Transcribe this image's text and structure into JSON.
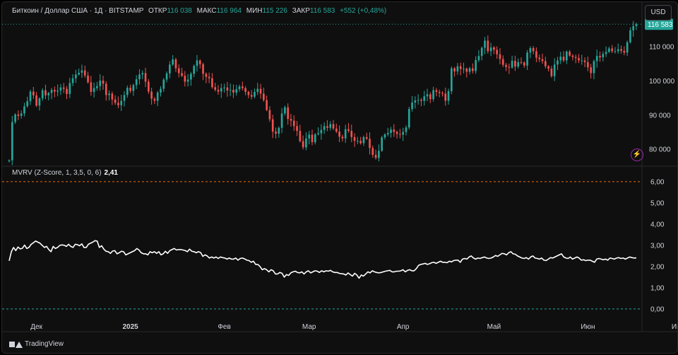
{
  "header": {
    "symbol": "Биткоин / Доллар США · 1Д · BITSTAMP",
    "open_label": "ОТКР",
    "open_value": "116 038",
    "high_label": "МАКС",
    "high_value": "116 964",
    "low_label": "МИН",
    "low_value": "115 226",
    "close_label": "ЗАКР",
    "close_value": "116 583",
    "change": "+552 (+0,48%)"
  },
  "currency_button": "USD",
  "indicator": {
    "name": "MVRV (Z-Score, 1, 3,5, 0, 6)",
    "value": "2,41"
  },
  "footer": {
    "brand": "TradingView"
  },
  "colors": {
    "up": "#26a69a",
    "down": "#ef5350",
    "line": "#ffffff",
    "price_tag": "#26a69a",
    "upper_band": "#ef6c00",
    "lower_band": "#26a69a"
  },
  "chart_data": [
    {
      "type": "candlestick",
      "title": "Биткоин / Доллар США · 1Д · BITSTAMP",
      "price_axis_ticks": [
        "80 000",
        "90 000",
        "100 000",
        "110 000"
      ],
      "price_tick_values": [
        80000,
        90000,
        100000,
        110000
      ],
      "ylim": [
        75500,
        118500
      ],
      "last_price_label": "116 583",
      "last_price": 116583,
      "time_axis_labels": [
        "Дек",
        "2025",
        "Фев",
        "Мар",
        "Апр",
        "Май",
        "Июн",
        "Июл"
      ],
      "time_axis_label_index": [
        9,
        40,
        71,
        99,
        130,
        160,
        191,
        221
      ],
      "series": [
        {
          "name": "Close",
          "start_open": 76500,
          "close": [
            76800,
            88000,
            90200,
            89800,
            90500,
            92600,
            94100,
            96900,
            95800,
            92800,
            94900,
            97300,
            95800,
            96500,
            97400,
            96900,
            97200,
            98100,
            97700,
            96200,
            99400,
            100800,
            101900,
            102400,
            103100,
            101600,
            99600,
            96800,
            97900,
            98500,
            100100,
            99200,
            95900,
            96300,
            94600,
            93600,
            92900,
            94200,
            95900,
            98000,
            97100,
            98800,
            100500,
            101900,
            102300,
            99800,
            96900,
            94800,
            94200,
            96600,
            97700,
            100400,
            102200,
            104800,
            106300,
            103700,
            102300,
            101500,
            99800,
            100400,
            102100,
            104400,
            106000,
            104900,
            102100,
            101200,
            100800,
            98200,
            97400,
            96900,
            97900,
            98100,
            97200,
            97400,
            96600,
            97600,
            98400,
            97900,
            96800,
            95900,
            95400,
            96800,
            97700,
            96300,
            94400,
            91500,
            88800,
            85200,
            84600,
            86300,
            90500,
            92300,
            88900,
            88400,
            86800,
            85400,
            82400,
            80600,
            83200,
            84300,
            82100,
            84400,
            84700,
            85700,
            86800,
            86300,
            87400,
            86100,
            85200,
            83700,
            83200,
            85900,
            85400,
            83600,
            82500,
            82500,
            81800,
            83600,
            83100,
            80400,
            78400,
            77500,
            79600,
            83500,
            84400,
            84800,
            85800,
            85100,
            84500,
            84300,
            85100,
            86400,
            91800,
            93700,
            94300,
            94500,
            94200,
            95500,
            96100,
            94700,
            97300,
            96800,
            96500,
            96300,
            94200,
            97000,
            103700,
            102800,
            104300,
            103500,
            103600,
            102700,
            103700,
            102900,
            106100,
            107300,
            109700,
            111800,
            108700,
            109800,
            109100,
            107800,
            106400,
            104700,
            104100,
            103900,
            105900,
            104200,
            105500,
            105400,
            104500,
            108300,
            109600,
            108700,
            106800,
            106400,
            105800,
            104300,
            103600,
            101400,
            104800,
            106000,
            107100,
            106000,
            108600,
            107400,
            107000,
            106700,
            106000,
            106000,
            105500,
            104000,
            102300,
            105800,
            107300,
            106900,
            107900,
            108500,
            109500,
            108700,
            108700,
            109300,
            108800,
            108300,
            111300,
            114800,
            116038,
            116583
          ]
        }
      ]
    },
    {
      "type": "line",
      "title": "MVRV (Z-Score, 1, 3,5, 0, 6)",
      "y_axis_ticks": [
        "0,00",
        "1,00",
        "2,00",
        "3,00",
        "4,00",
        "5,00",
        "6,00"
      ],
      "y_tick_values": [
        0,
        1,
        2,
        3,
        4,
        5,
        6
      ],
      "ylim": [
        -0.67,
        6.33
      ],
      "bands": [
        {
          "value": 6,
          "label": "6,00"
        },
        {
          "value": 0,
          "label": "0,00"
        }
      ],
      "last_value_label": "2,41",
      "series": [
        {
          "name": "MVRV (Z-Score, 1, 3,5, 0, 6)",
          "values": [
            2.27,
            2.7,
            2.9,
            2.75,
            2.92,
            2.83,
            2.86,
            3.01,
            2.85,
            2.9,
            3.05,
            3.12,
            3.2,
            3.15,
            3.1,
            3.0,
            2.9,
            2.95,
            2.8,
            2.7,
            2.95,
            2.85,
            2.9,
            3.0,
            3.02,
            3.0,
            2.95,
            3.05,
            2.95,
            2.9,
            3.05,
            3.03,
            2.98,
            3.07,
            2.9,
            2.9,
            3.05,
            3.1,
            3.15,
            3.22,
            3.2,
            2.9,
            2.98,
            2.82,
            2.72,
            2.7,
            2.62,
            2.73,
            2.75,
            2.6,
            2.65,
            2.72,
            2.7,
            2.55,
            2.6,
            2.65,
            2.7,
            2.75,
            2.85,
            2.78,
            2.65,
            2.6,
            2.6,
            2.55,
            2.7,
            2.65,
            2.7,
            2.62,
            2.7,
            2.55,
            2.6,
            2.72,
            2.62,
            2.75,
            2.8,
            2.85,
            2.78,
            2.8,
            2.8,
            2.78,
            2.75,
            2.7,
            2.82,
            2.72,
            2.7,
            2.65,
            2.7,
            2.66,
            2.48,
            2.55,
            2.5,
            2.4,
            2.45,
            2.4,
            2.45,
            2.38,
            2.45,
            2.42,
            2.4,
            2.35,
            2.4,
            2.35,
            2.35,
            2.4,
            2.3,
            2.38,
            2.4,
            2.36,
            2.3,
            2.28,
            2.2,
            2.25,
            2.1,
            2.1,
            2.0,
            1.85,
            1.9,
            1.85,
            1.75,
            1.85,
            1.8,
            1.65,
            1.65,
            1.72,
            1.68,
            1.5,
            1.62,
            1.58,
            1.7,
            1.75,
            1.78,
            1.72,
            1.7,
            1.75,
            1.65,
            1.75,
            1.8,
            1.7,
            1.75,
            1.8,
            1.78,
            1.72,
            1.8,
            1.75,
            1.8,
            1.78,
            1.82,
            1.75,
            1.72,
            1.72,
            1.68,
            1.66,
            1.65,
            1.6,
            1.7,
            1.62,
            1.55,
            1.68,
            1.6,
            1.45,
            1.6,
            1.55,
            1.65,
            1.75,
            1.7,
            1.8,
            1.75,
            1.72,
            1.7,
            1.72,
            1.75,
            1.78,
            1.8,
            1.82,
            1.75,
            1.75,
            1.78,
            1.78,
            1.8,
            1.85,
            1.75,
            1.82,
            1.85,
            1.8,
            1.8,
            1.9,
            2.05,
            2.1,
            2.12,
            2.15,
            2.1,
            2.13,
            2.18,
            2.2,
            2.15,
            2.2,
            2.25,
            2.2,
            2.2,
            2.18,
            2.25,
            2.22,
            2.28,
            2.3,
            2.3,
            2.2,
            2.35,
            2.38,
            2.35,
            2.45,
            2.5,
            2.4,
            2.35,
            2.4,
            2.38,
            2.42,
            2.45,
            2.4,
            2.38,
            2.4,
            2.45,
            2.52,
            2.48,
            2.55,
            2.62,
            2.6,
            2.55,
            2.65,
            2.7,
            2.6,
            2.58,
            2.5,
            2.45,
            2.4,
            2.38,
            2.42,
            2.35,
            2.45,
            2.5,
            2.4,
            2.38,
            2.35,
            2.4,
            2.3,
            2.28,
            2.35,
            2.42,
            2.4,
            2.45,
            2.5,
            2.55,
            2.6,
            2.45,
            2.4,
            2.38,
            2.45,
            2.35,
            2.4,
            2.45,
            2.4,
            2.3,
            2.32,
            2.28,
            2.3,
            2.3,
            2.25,
            2.2,
            2.35,
            2.38,
            2.35,
            2.32,
            2.35,
            2.3,
            2.4,
            2.38,
            2.35,
            2.4,
            2.42,
            2.38,
            2.4,
            2.35,
            2.4,
            2.45,
            2.42,
            2.4,
            2.41
          ]
        }
      ]
    }
  ]
}
